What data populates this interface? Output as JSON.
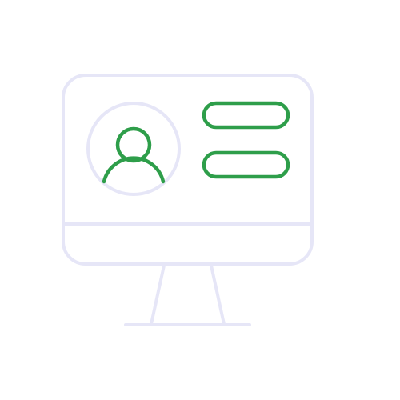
{
  "illustration": {
    "subject": "desktop-monitor-user-profile-icon",
    "icons": {
      "monitor": "monitor-icon",
      "avatar": "user-avatar-icon",
      "info_lines": "profile-info-bar-icon"
    }
  },
  "colors": {
    "background": "#ffffff",
    "outline": "#e6e6f7",
    "accent": "#2e9e4a"
  }
}
